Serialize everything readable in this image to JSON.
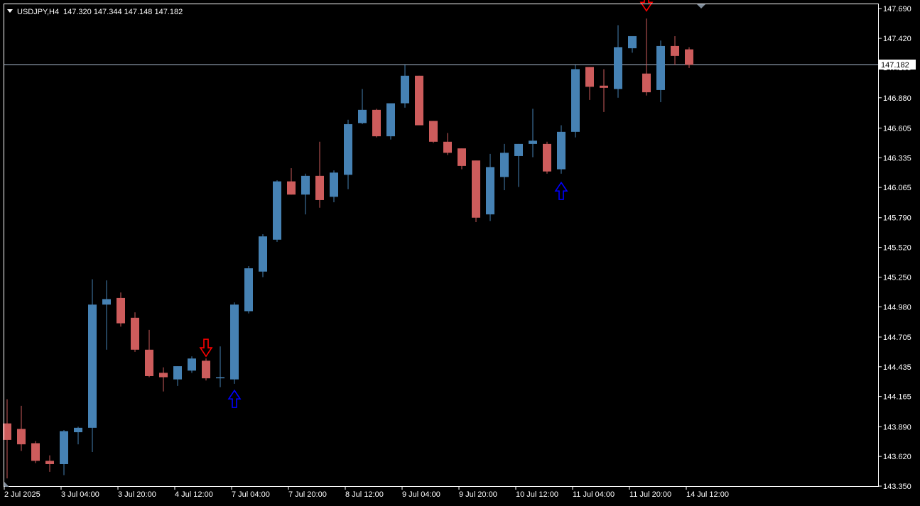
{
  "header": {
    "symbol_timeframe": "USDJPY,H4",
    "ohlc": "147.320 147.344 147.148 147.182"
  },
  "colors": {
    "background": "#000000",
    "frame": "#ffffff",
    "bull": "#4682b4",
    "bear": "#cd5c5c",
    "price_line": "#a9b8cc",
    "sell_arrow": "#ff0000",
    "buy_arrow": "#0000ff"
  },
  "chart_data": {
    "type": "candlestick",
    "title": "",
    "xlabel": "",
    "ylabel": "",
    "ylim": [
      143.35,
      147.73
    ],
    "y_ticks": [
      "147.690",
      "147.420",
      "147.155",
      "146.880",
      "146.605",
      "146.335",
      "146.065",
      "145.790",
      "145.520",
      "145.250",
      "144.980",
      "144.705",
      "144.435",
      "144.165",
      "143.890",
      "143.620",
      "143.350"
    ],
    "x_ticks": [
      "2 Jul 2025",
      "3 Jul 04:00",
      "3 Jul 20:00",
      "4 Jul 12:00",
      "7 Jul 04:00",
      "7 Jul 20:00",
      "8 Jul 12:00",
      "9 Jul 04:00",
      "9 Jul 20:00",
      "10 Jul 12:00",
      "11 Jul 04:00",
      "11 Jul 20:00",
      "14 Jul 12:00"
    ],
    "last_price": "147.182",
    "candles": [
      {
        "o": 143.92,
        "h": 144.14,
        "l": 143.42,
        "c": 143.77
      },
      {
        "o": 143.87,
        "h": 144.08,
        "l": 143.67,
        "c": 143.73
      },
      {
        "o": 143.74,
        "h": 143.76,
        "l": 143.56,
        "c": 143.58
      },
      {
        "o": 143.58,
        "h": 143.63,
        "l": 143.48,
        "c": 143.55
      },
      {
        "o": 143.55,
        "h": 143.86,
        "l": 143.45,
        "c": 143.85
      },
      {
        "o": 143.84,
        "h": 143.89,
        "l": 143.73,
        "c": 143.88
      },
      {
        "o": 143.88,
        "h": 145.23,
        "l": 143.66,
        "c": 145.0
      },
      {
        "o": 145.0,
        "h": 145.22,
        "l": 144.59,
        "c": 145.05
      },
      {
        "o": 145.06,
        "h": 145.11,
        "l": 144.8,
        "c": 144.83
      },
      {
        "o": 144.88,
        "h": 144.93,
        "l": 144.57,
        "c": 144.59
      },
      {
        "o": 144.59,
        "h": 144.77,
        "l": 144.34,
        "c": 144.35
      },
      {
        "o": 144.38,
        "h": 144.43,
        "l": 144.21,
        "c": 144.34
      },
      {
        "o": 144.32,
        "h": 144.44,
        "l": 144.26,
        "c": 144.44
      },
      {
        "o": 144.4,
        "h": 144.53,
        "l": 144.38,
        "c": 144.51
      },
      {
        "o": 144.49,
        "h": 144.51,
        "l": 144.31,
        "c": 144.33
      },
      {
        "o": 144.33,
        "h": 144.62,
        "l": 144.25,
        "c": 144.34
      },
      {
        "o": 144.32,
        "h": 145.02,
        "l": 144.28,
        "c": 145.0
      },
      {
        "o": 144.94,
        "h": 145.35,
        "l": 144.92,
        "c": 145.33
      },
      {
        "o": 145.3,
        "h": 145.64,
        "l": 145.25,
        "c": 145.62
      },
      {
        "o": 145.59,
        "h": 146.13,
        "l": 145.57,
        "c": 146.12
      },
      {
        "o": 146.12,
        "h": 146.24,
        "l": 146.0,
        "c": 146.0
      },
      {
        "o": 146.0,
        "h": 146.19,
        "l": 145.82,
        "c": 146.17
      },
      {
        "o": 146.17,
        "h": 146.48,
        "l": 145.88,
        "c": 145.95
      },
      {
        "o": 145.98,
        "h": 146.22,
        "l": 145.93,
        "c": 146.2
      },
      {
        "o": 146.18,
        "h": 146.68,
        "l": 146.05,
        "c": 146.64
      },
      {
        "o": 146.65,
        "h": 146.96,
        "l": 146.64,
        "c": 146.77
      },
      {
        "o": 146.77,
        "h": 146.78,
        "l": 146.52,
        "c": 146.53
      },
      {
        "o": 146.53,
        "h": 146.83,
        "l": 146.5,
        "c": 146.83
      },
      {
        "o": 146.83,
        "h": 147.18,
        "l": 146.79,
        "c": 147.08
      },
      {
        "o": 147.08,
        "h": 147.08,
        "l": 146.63,
        "c": 146.63
      },
      {
        "o": 146.67,
        "h": 146.67,
        "l": 146.47,
        "c": 146.48
      },
      {
        "o": 146.48,
        "h": 146.56,
        "l": 146.36,
        "c": 146.38
      },
      {
        "o": 146.42,
        "h": 146.42,
        "l": 146.23,
        "c": 146.26
      },
      {
        "o": 146.31,
        "h": 146.31,
        "l": 145.75,
        "c": 145.79
      },
      {
        "o": 145.82,
        "h": 146.37,
        "l": 145.76,
        "c": 146.25
      },
      {
        "o": 146.16,
        "h": 146.46,
        "l": 146.04,
        "c": 146.38
      },
      {
        "o": 146.35,
        "h": 146.46,
        "l": 146.07,
        "c": 146.46
      },
      {
        "o": 146.46,
        "h": 146.78,
        "l": 146.34,
        "c": 146.49
      },
      {
        "o": 146.46,
        "h": 146.48,
        "l": 146.19,
        "c": 146.21
      },
      {
        "o": 146.23,
        "h": 146.63,
        "l": 146.19,
        "c": 146.57
      },
      {
        "o": 146.57,
        "h": 147.18,
        "l": 146.52,
        "c": 147.14
      },
      {
        "o": 147.16,
        "h": 147.16,
        "l": 146.86,
        "c": 146.98
      },
      {
        "o": 146.99,
        "h": 147.14,
        "l": 146.75,
        "c": 146.97
      },
      {
        "o": 146.96,
        "h": 147.54,
        "l": 146.88,
        "c": 147.34
      },
      {
        "o": 147.33,
        "h": 147.43,
        "l": 147.29,
        "c": 147.44
      },
      {
        "o": 147.1,
        "h": 147.6,
        "l": 146.9,
        "c": 146.93
      },
      {
        "o": 146.95,
        "h": 147.4,
        "l": 146.84,
        "c": 147.35
      },
      {
        "o": 147.35,
        "h": 147.44,
        "l": 147.18,
        "c": 147.26
      },
      {
        "o": 147.32,
        "h": 147.34,
        "l": 147.15,
        "c": 147.18
      }
    ],
    "signals": [
      {
        "type": "sell",
        "candle": 14,
        "price": 144.53
      },
      {
        "type": "buy",
        "candle": 16,
        "price": 144.22
      },
      {
        "type": "buy",
        "candle": 39,
        "price": 146.11
      },
      {
        "type": "sell",
        "candle": 45,
        "price": 147.67
      }
    ]
  }
}
